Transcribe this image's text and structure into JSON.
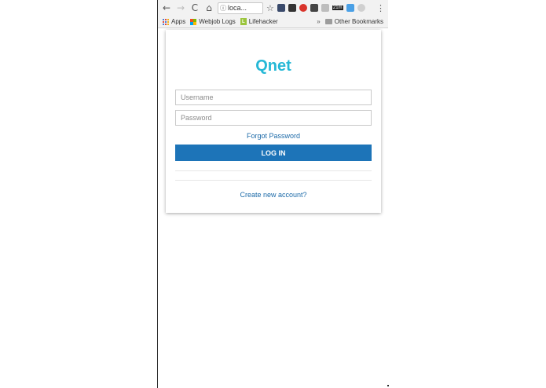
{
  "browser": {
    "nav": {
      "back": "←",
      "forward": "→",
      "reload": "C",
      "home": "⌂"
    },
    "omnibox": {
      "info_icon": "ⓘ",
      "url": "loca..."
    },
    "star": "☆",
    "extensions_badge": "21m",
    "menu": "⋮",
    "bookmarks": [
      {
        "label": "Apps",
        "icon": "apps-grid-icon"
      },
      {
        "label": "Webjob Logs",
        "icon": "windows-logo-icon"
      },
      {
        "label": "Lifehacker",
        "icon": "lifehacker-icon"
      }
    ],
    "overflow": "»",
    "other_bookmarks": "Other Bookmarks"
  },
  "login": {
    "logo": "Qnet",
    "username_placeholder": "Username",
    "password_placeholder": "Password",
    "forgot_password": "Forgot Password",
    "login_button": "LOG IN",
    "create_account": "Create new account?"
  },
  "colors": {
    "brand": "#26b8d6",
    "primary_button": "#1d74b8",
    "link": "#1c6aa8"
  }
}
